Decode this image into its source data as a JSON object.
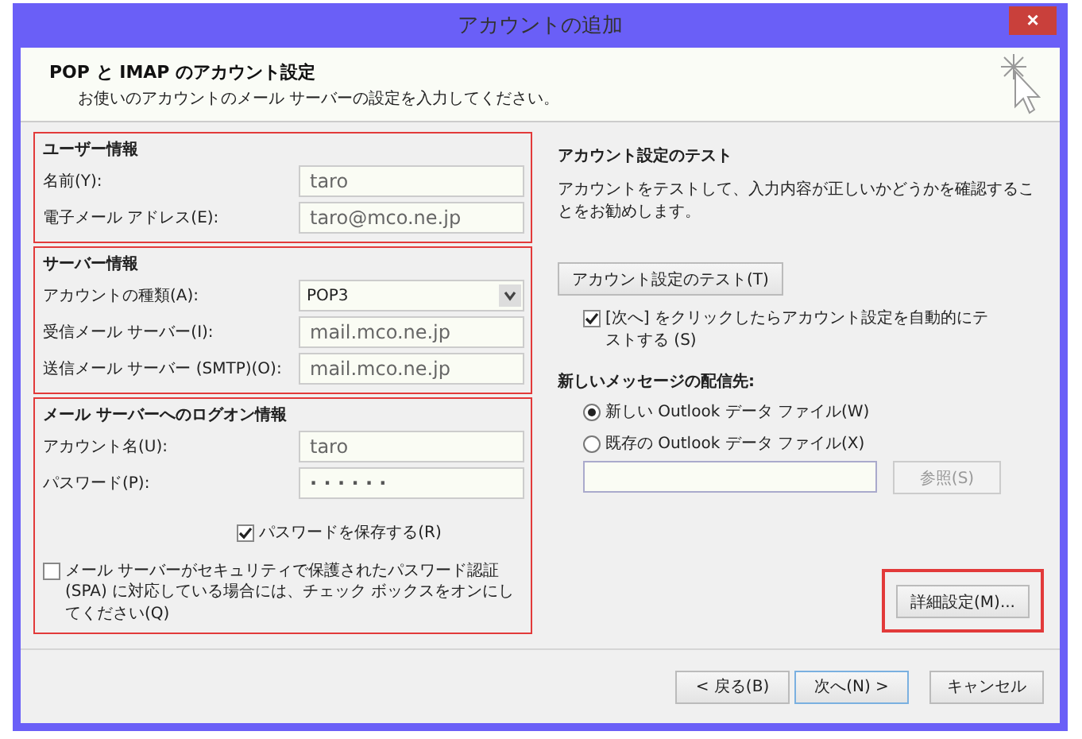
{
  "window": {
    "title": "アカウントの追加",
    "close": "×"
  },
  "header": {
    "title": "POP と IMAP のアカウント設定",
    "subtitle": "お使いのアカウントのメール サーバーの設定を入力してください。"
  },
  "sections": [
    {
      "heading": "ユーザー情報",
      "highlighted": true,
      "rows": [
        {
          "kind": "text",
          "label": "名前(Y):",
          "value": "taro"
        },
        {
          "kind": "text",
          "label": "電子メール アドレス(E):",
          "value": "taro@mco.ne.jp"
        }
      ]
    },
    {
      "heading": "サーバー情報",
      "highlighted": true,
      "rows": [
        {
          "kind": "dropdown",
          "label": "アカウントの種類(A):",
          "value": "POP3"
        },
        {
          "kind": "text",
          "label": "受信メール サーバー(I):",
          "value": "mail.mco.ne.jp"
        },
        {
          "kind": "text",
          "label": "送信メール サーバー (SMTP)(O):",
          "value": "mail.mco.ne.jp"
        }
      ]
    },
    {
      "heading": "メール サーバーへのログオン情報",
      "highlighted": true,
      "rows": [
        {
          "kind": "text",
          "label": "アカウント名(U):",
          "value": "taro"
        },
        {
          "kind": "password",
          "label": "パスワード(P):",
          "value": "· · · · · ·"
        },
        {
          "kind": "checkbox",
          "label": "パスワードを保存する(R)",
          "checked": true
        },
        {
          "kind": "wide_checkbox",
          "label": "メール サーバーがセキュリティで保護されたパスワード認証 (SPA) に対応している場合には、チェック ボックスをオンにしてください(Q)",
          "checked": false
        }
      ]
    }
  ],
  "test": {
    "heading": "アカウント設定のテスト",
    "description": "アカウントをテストして、入力内容が正しいかどうかを確認することをお勧めします。",
    "button": "アカウント設定のテスト(T)",
    "auto_test": {
      "label": "[次へ] をクリックしたらアカウント設定を自動的にテストする (S)",
      "checked": true
    }
  },
  "delivery": {
    "heading": "新しいメッセージの配信先:",
    "options": [
      {
        "label": "新しい Outlook データ ファイル(W)",
        "selected": true
      },
      {
        "label": "既存の Outlook データ ファイル(X)",
        "selected": false
      }
    ],
    "browse": {
      "label": "参照(S)",
      "disabled": true
    }
  },
  "advanced": {
    "label": "詳細設定(M)...",
    "highlighted": true
  },
  "buttons": [
    {
      "label": "< 戻る(B)",
      "default": false
    },
    {
      "label": "次へ(N) >",
      "default": true
    },
    {
      "label": "キャンセル",
      "default": false
    }
  ]
}
